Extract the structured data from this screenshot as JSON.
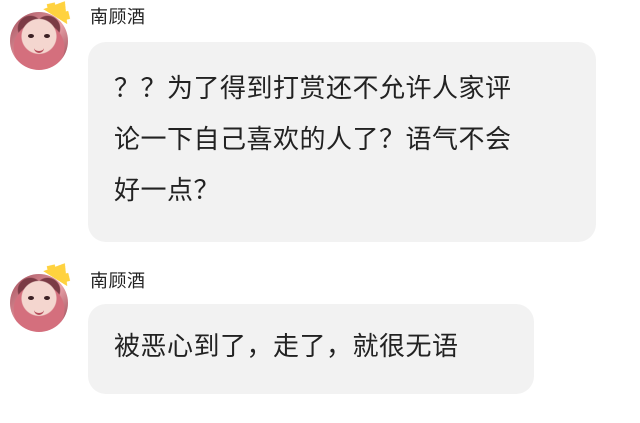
{
  "messages": [
    {
      "sender": "南顾酒",
      "lines": [
        "？？为了得到打赏还不允许人家评",
        "论一下自己喜欢的人了？语气不会",
        "好一点？"
      ]
    },
    {
      "sender": "南顾酒",
      "lines": [
        "被恶心到了，走了，就很无语"
      ]
    }
  ],
  "colors": {
    "bubble_bg": "#f2f2f2",
    "text": "#222222",
    "crown": "#ffd23f"
  },
  "icons": {
    "avatar_badge": "crown-icon"
  }
}
